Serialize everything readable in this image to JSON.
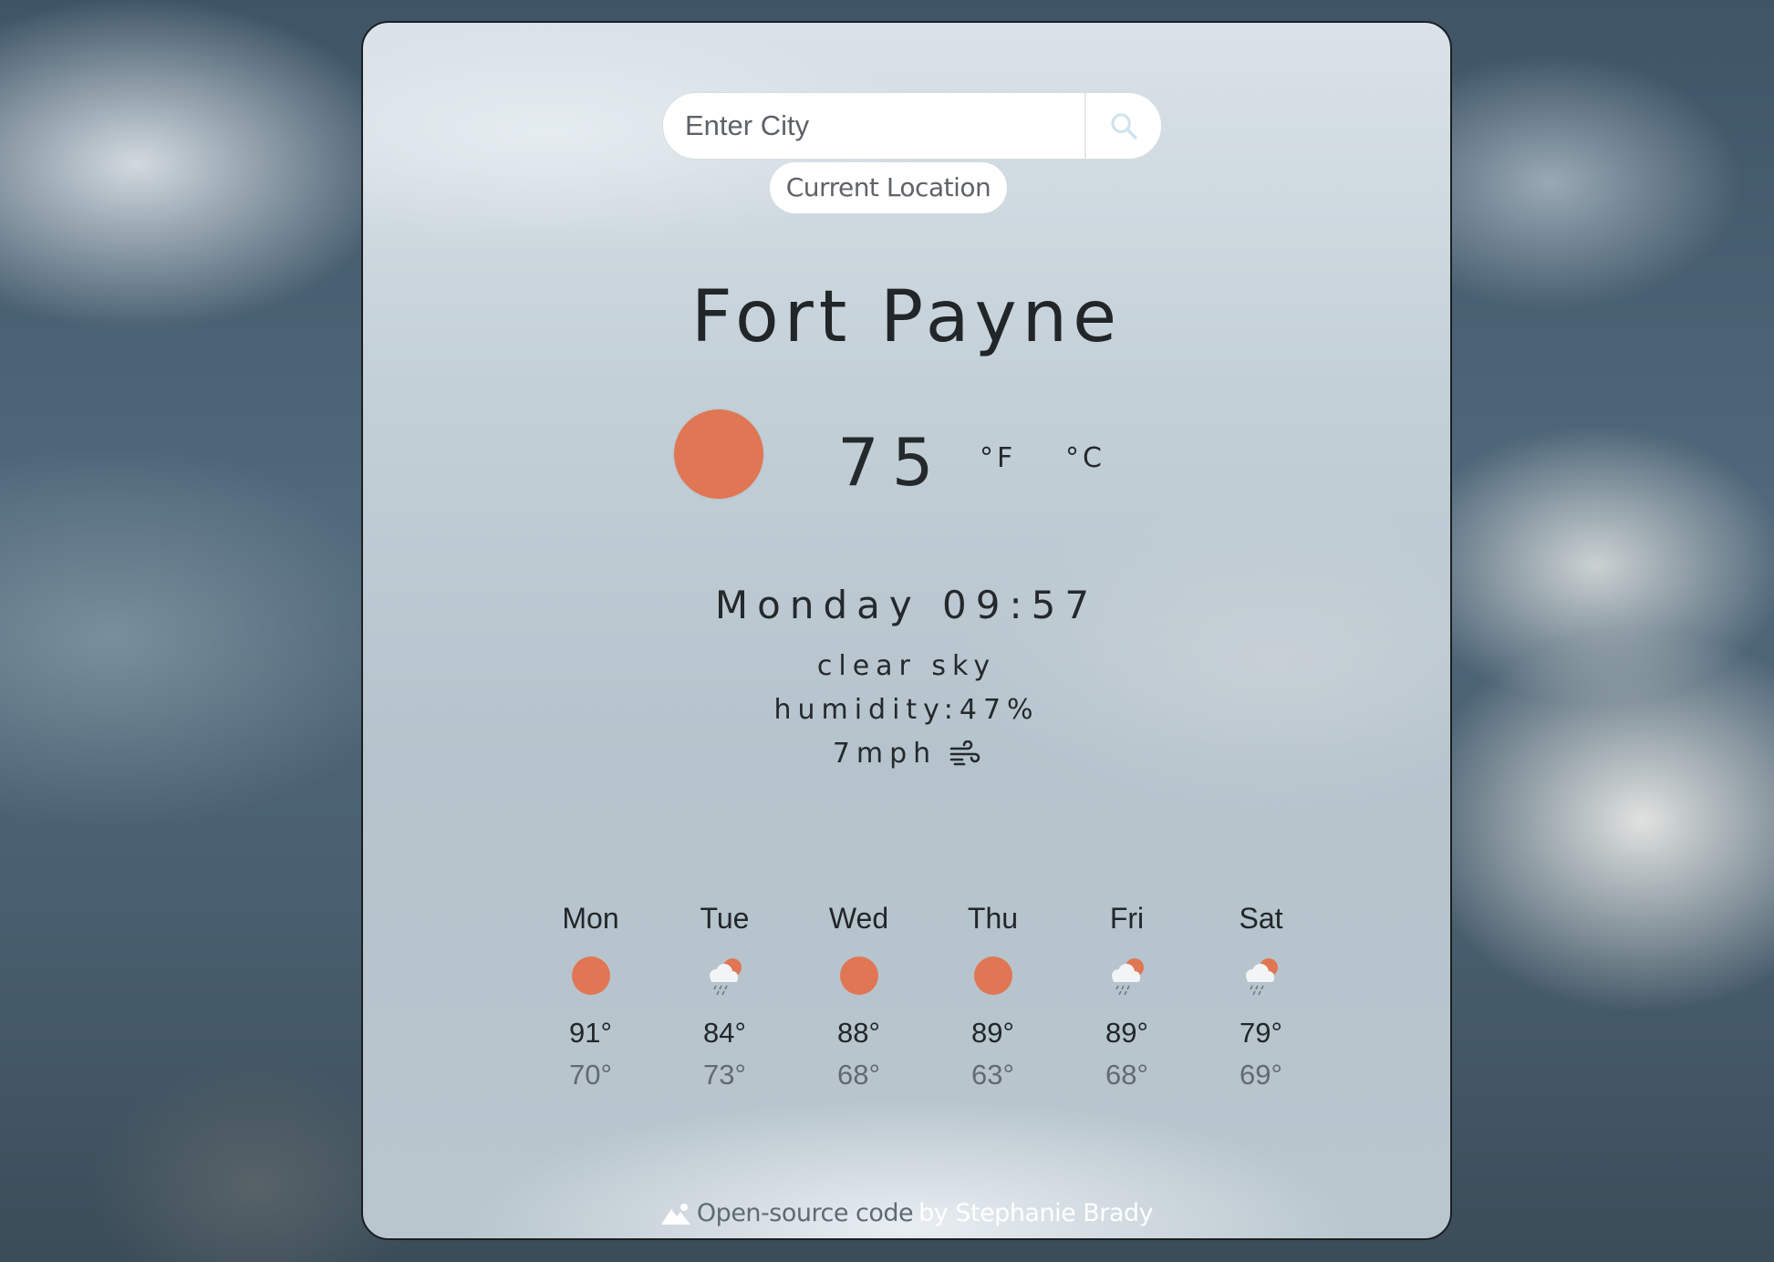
{
  "search": {
    "placeholder": "Enter City",
    "button_icon": "search-icon"
  },
  "current_location_label": "Current Location",
  "city": "Fort Payne",
  "current": {
    "icon": "sun-icon",
    "temperature": "75",
    "unit_f": "°F",
    "unit_c": "°C",
    "datetime": "Monday 09:57",
    "description": "clear sky",
    "humidity": "humidity:47%",
    "wind": "7mph",
    "wind_icon": "wind-icon"
  },
  "forecast": [
    {
      "day": "Mon",
      "icon": "sun-icon",
      "hi": "91°",
      "lo": "70°"
    },
    {
      "day": "Tue",
      "icon": "sun-rain-cloud-icon",
      "hi": "84°",
      "lo": "73°"
    },
    {
      "day": "Wed",
      "icon": "sun-icon",
      "hi": "88°",
      "lo": "68°"
    },
    {
      "day": "Thu",
      "icon": "sun-icon",
      "hi": "89°",
      "lo": "63°"
    },
    {
      "day": "Fri",
      "icon": "sun-rain-cloud-icon",
      "hi": "89°",
      "lo": "68°"
    },
    {
      "day": "Sat",
      "icon": "sun-rain-cloud-icon",
      "hi": "79°",
      "lo": "69°"
    }
  ],
  "footer": {
    "link_text": "Open-source code",
    "by_text": "by Stephanie Brady",
    "icon": "mountain-icon"
  },
  "colors": {
    "accent": "#e07653"
  }
}
